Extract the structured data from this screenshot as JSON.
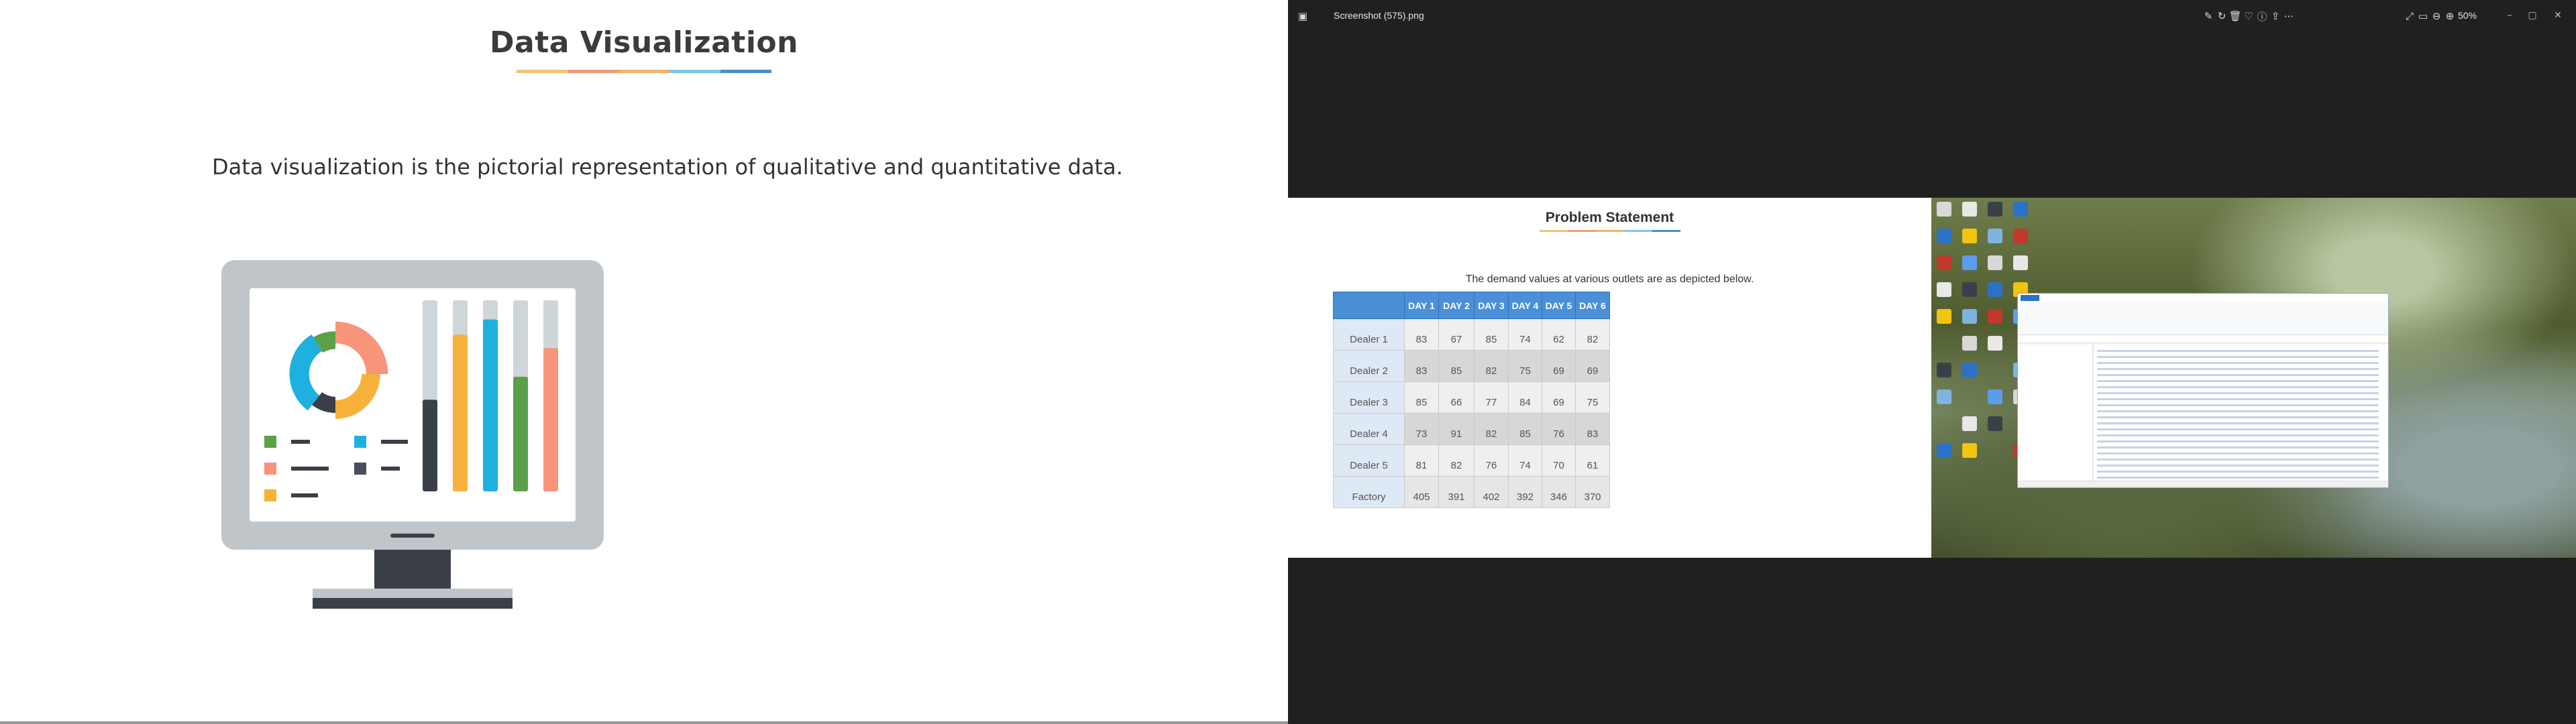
{
  "slide": {
    "title": "Data Visualization",
    "underline_colors": [
      "#f5c07a",
      "#f29d7c",
      "#f5b26b",
      "#7cc7e8",
      "#4a8ec7"
    ],
    "body_text": "Data visualization is the pictorial representation of qualitative and quantitative data."
  },
  "illustration": {
    "colors": {
      "bezel": "#bfc5c9",
      "dark": "#3b4048",
      "blue": "#1fb0e0",
      "green": "#5aa14a",
      "orange": "#f7b23b",
      "salmon": "#f7947a",
      "gray": "#cfd6d9",
      "dark_slate": "#4b4e5e"
    },
    "bar_levels": [
      {
        "fill": 0.48,
        "color": "#3b4048"
      },
      {
        "fill": 0.82,
        "color": "#f7b23b"
      },
      {
        "fill": 0.9,
        "color": "#1fb0e0"
      },
      {
        "fill": 0.6,
        "color": "#5aa14a"
      },
      {
        "fill": 0.75,
        "color": "#f7947a"
      }
    ]
  },
  "viewer": {
    "file_name": "Screenshot (575).png",
    "zoom_level": "50%",
    "icons": [
      "crop-icon",
      "rotate-icon",
      "delete-icon",
      "favorite-icon",
      "info-icon",
      "share-icon",
      "more-icon",
      "fullscreen-icon",
      "slideshow-icon",
      "zoom-out-icon",
      "zoom-in-icon"
    ]
  },
  "problem_statement": {
    "title": "Problem Statement",
    "description": "The demand values at various outlets are as depicted below.",
    "columns": [
      "DAY 1",
      "DAY 2",
      "DAY 3",
      "DAY 4",
      "DAY 5",
      "DAY 6"
    ],
    "rows": [
      {
        "label": "Dealer 1",
        "values": [
          "83",
          "67",
          "85",
          "74",
          "62",
          "82"
        ]
      },
      {
        "label": "Dealer 2",
        "values": [
          "83",
          "85",
          "82",
          "75",
          "69",
          "69"
        ]
      },
      {
        "label": "Dealer 3",
        "values": [
          "85",
          "66",
          "77",
          "84",
          "69",
          "75"
        ]
      },
      {
        "label": "Dealer 4",
        "values": [
          "73",
          "91",
          "82",
          "85",
          "76",
          "83"
        ]
      },
      {
        "label": "Dealer 5",
        "values": [
          "81",
          "82",
          "76",
          "74",
          "70",
          "61"
        ]
      },
      {
        "label": "Factory",
        "values": [
          "405",
          "391",
          "402",
          "392",
          "346",
          "370"
        ]
      }
    ]
  }
}
